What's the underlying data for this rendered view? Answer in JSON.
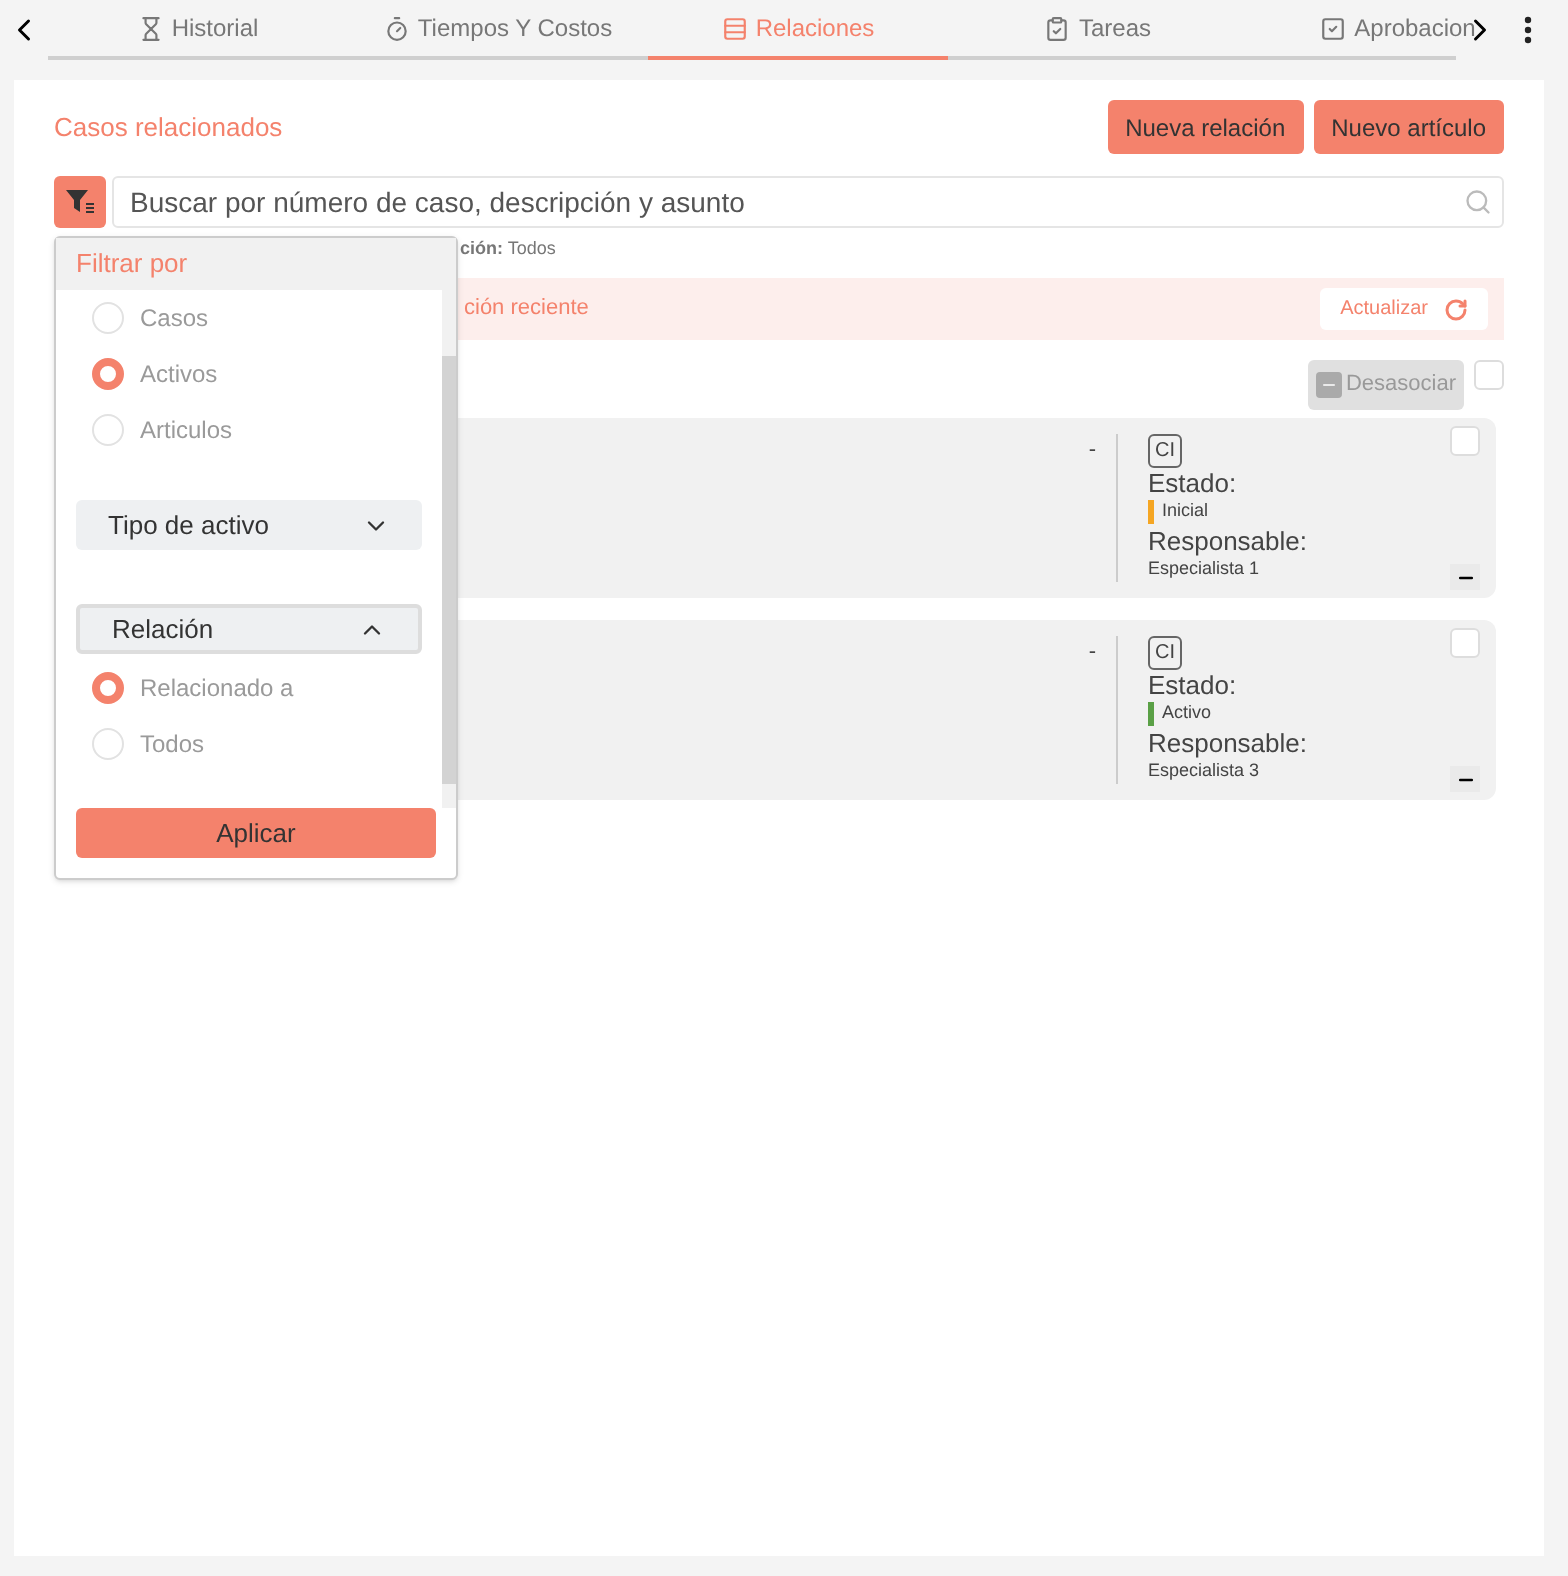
{
  "tabs": [
    {
      "label": "Historial",
      "selected": false
    },
    {
      "label": "Tiempos Y Costos",
      "selected": false
    },
    {
      "label": "Relaciones",
      "selected": true
    },
    {
      "label": "Tareas",
      "selected": false
    },
    {
      "label": "Aprobacion",
      "selected": false
    }
  ],
  "section_title": "Casos relacionados",
  "buttons": [
    "Nueva relación",
    "Nuevo artículo"
  ],
  "search": {
    "placeholder": "Buscar por número de caso, descripción y asunto"
  },
  "filter_summary": "**ción:** Todos",
  "alert": {
    "text": "ción reciente",
    "button": "Actualizar"
  },
  "unlink_button": {
    "label": "Desasociar",
    "disabled": true
  },
  "select_all": {
    "checked": false
  },
  "cards": [
    {
      "dash": "-",
      "badge": "CI",
      "state_label": "Estado:",
      "state": "Inicial",
      "color": "#f5a623",
      "owner_label": "Responsable:",
      "owner": "Especialista 1",
      "checked": false
    },
    {
      "dash": "-",
      "badge": "CI",
      "state_label": "Estado:",
      "state": "Activo",
      "color": "#5aa046",
      "owner_label": "Responsable:",
      "owner": "Especialista 3",
      "checked": false
    }
  ],
  "filter_popup": {
    "title": "Filtrar por",
    "types": [
      {
        "label": "Casos",
        "selected": false
      },
      {
        "label": "Activos",
        "selected": true
      },
      {
        "label": "Articulos",
        "selected": false
      }
    ],
    "asset_type": {
      "label": "Tipo de activo",
      "expanded": false
    },
    "relation": {
      "label": "Relación",
      "expanded": true,
      "options": [
        {
          "label": "Relacionado a",
          "selected": true
        },
        {
          "label": "Todos",
          "selected": false
        }
      ]
    },
    "apply": "Aplicar"
  }
}
